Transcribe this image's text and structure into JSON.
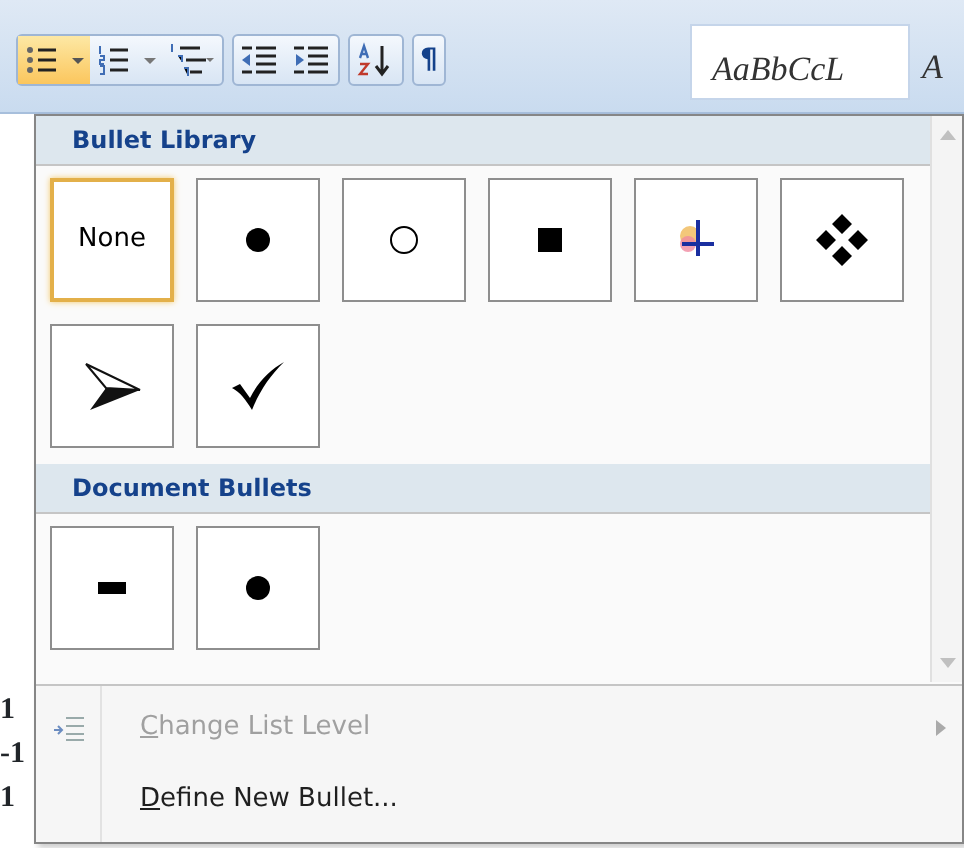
{
  "toolbar": {
    "buttons": [
      {
        "kind": "bullets",
        "selected": true
      },
      {
        "kind": "bullets-caret",
        "selected": true
      },
      {
        "kind": "numbering",
        "selected": false
      },
      {
        "kind": "numbering-caret",
        "selected": false
      },
      {
        "kind": "multilevel",
        "selected": false
      },
      {
        "kind": "decrease-indent",
        "selected": false
      },
      {
        "kind": "increase-indent",
        "selected": false
      },
      {
        "kind": "sort",
        "selected": false
      },
      {
        "kind": "text",
        "label": "¶",
        "selected": false
      }
    ],
    "style_preview": "AaBbCcL",
    "next_style": "A"
  },
  "document_edge": [
    "1",
    "-1",
    "1"
  ],
  "menu": {
    "sections": [
      {
        "title": "Bullet Library",
        "tiles": [
          {
            "kind": "none",
            "label": "None",
            "selected": true
          },
          {
            "kind": "dot",
            "selected": false
          },
          {
            "kind": "circle",
            "selected": false
          },
          {
            "kind": "square",
            "selected": false
          },
          {
            "kind": "picture",
            "selected": false
          },
          {
            "kind": "diamonds",
            "selected": false
          },
          {
            "kind": "arrow",
            "selected": false
          },
          {
            "kind": "check",
            "selected": false
          }
        ]
      },
      {
        "title": "Document Bullets",
        "tiles": [
          {
            "kind": "dash",
            "selected": false
          },
          {
            "kind": "dot",
            "selected": false
          }
        ]
      }
    ],
    "items": [
      {
        "label": "Change List Level",
        "disabled": true,
        "submenu": true
      },
      {
        "label": "Define New Bullet...",
        "disabled": false,
        "submenu": false
      }
    ]
  }
}
